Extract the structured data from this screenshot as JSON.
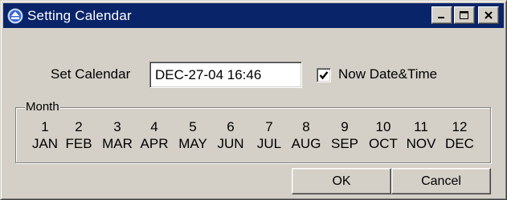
{
  "window": {
    "title": "Setting Calendar",
    "icon": "eject-icon",
    "colors": {
      "titlebar": "#0a246a",
      "face": "#d4d0c8"
    }
  },
  "form": {
    "set_calendar_label": "Set Calendar",
    "calendar_value": "DEC-27-04 16:46",
    "now_checkbox": {
      "label": "Now Date&Time",
      "checked": true
    }
  },
  "month_group": {
    "legend": "Month",
    "months": [
      {
        "num": "1",
        "abbr": "JAN"
      },
      {
        "num": "2",
        "abbr": "FEB"
      },
      {
        "num": "3",
        "abbr": "MAR"
      },
      {
        "num": "4",
        "abbr": "APR"
      },
      {
        "num": "5",
        "abbr": "MAY"
      },
      {
        "num": "6",
        "abbr": "JUN"
      },
      {
        "num": "7",
        "abbr": "JUL"
      },
      {
        "num": "8",
        "abbr": "AUG"
      },
      {
        "num": "9",
        "abbr": "SEP"
      },
      {
        "num": "10",
        "abbr": "OCT"
      },
      {
        "num": "11",
        "abbr": "NOV"
      },
      {
        "num": "12",
        "abbr": "DEC"
      }
    ]
  },
  "buttons": {
    "ok": "OK",
    "cancel": "Cancel"
  }
}
